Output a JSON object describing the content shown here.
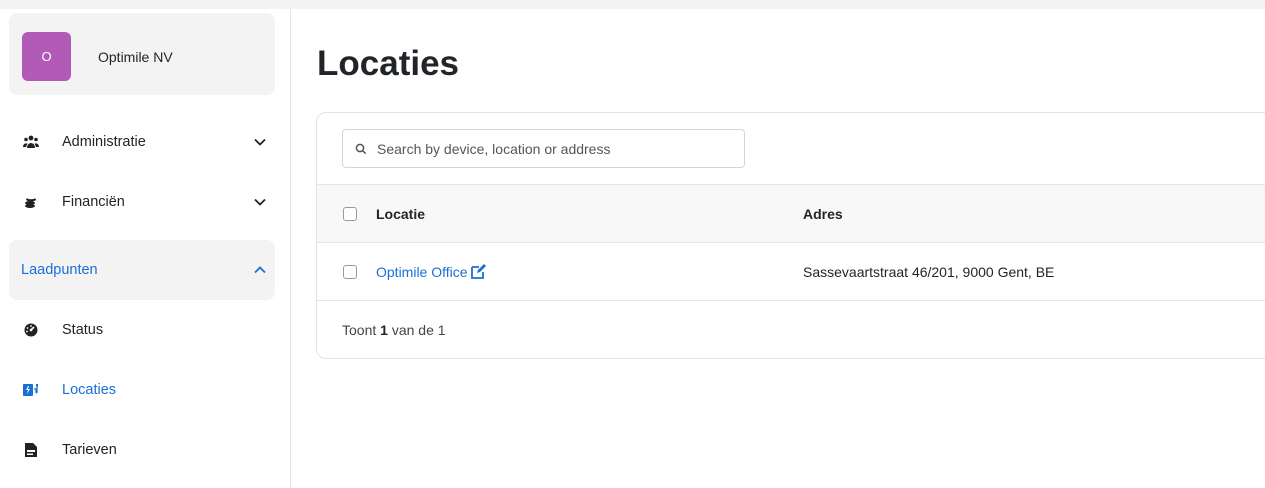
{
  "org": {
    "initial": "O",
    "name": "Optimile NV"
  },
  "nav": {
    "administratie": "Administratie",
    "financien": "Financiën",
    "laadpunten": "Laadpunten",
    "status": "Status",
    "locaties": "Locaties",
    "tarieven": "Tarieven"
  },
  "page": {
    "title": "Locaties"
  },
  "search": {
    "placeholder": "Search by device, location or address",
    "value": ""
  },
  "table": {
    "columns": [
      "Locatie",
      "Adres"
    ],
    "rows": [
      {
        "locatie": "Optimile Office",
        "adres": "Sassevaartstraat 46/201, 9000 Gent, BE"
      }
    ]
  },
  "footer": {
    "prefix": "Toont ",
    "shown": "1",
    "suffix": " van de 1"
  },
  "colors": {
    "accent": "#1a6fd6",
    "avatar": "#b15ab6"
  }
}
